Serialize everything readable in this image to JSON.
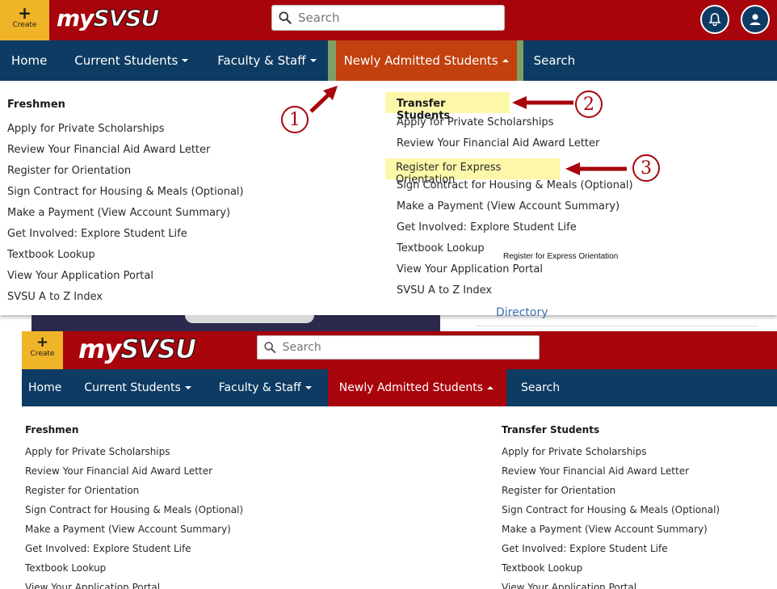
{
  "header": {
    "create_label": "Create",
    "create_symbol": "+",
    "logo_prefix": "my",
    "logo_brand": "SVSU",
    "search_placeholder": "Search"
  },
  "nav": {
    "home": "Home",
    "current_students": "Current Students",
    "faculty_staff": "Faculty & Staff",
    "newly_admitted": "Newly Admitted Students",
    "search": "Search"
  },
  "freshmen": {
    "heading": "Freshmen",
    "links": [
      "Apply for Private Scholarships",
      "Review Your Financial Aid Award Letter",
      "Register for Orientation",
      "Sign Contract for Housing & Meals (Optional)",
      "Make a Payment (View Account Summary)",
      "Get Involved: Explore Student Life",
      "Textbook Lookup",
      "View Your Application Portal",
      "SVSU A to Z Index"
    ]
  },
  "transfer": {
    "heading": "Transfer Students",
    "links_top": [
      "Apply for Private Scholarships",
      "Review Your Financial Aid Award Letter",
      "Register for Express Orientation",
      "Sign Contract for Housing & Meals (Optional)",
      "Make a Payment (View Account Summary)",
      "Get Involved: Explore Student Life",
      "Textbook Lookup",
      "View Your Application Portal",
      "SVSU A to Z Index"
    ],
    "links_bottom": [
      "Apply for Private Scholarships",
      "Review Your Financial Aid Award Letter",
      "Register for Orientation",
      "Sign Contract for Housing & Meals (Optional)",
      "Make a Payment (View Account Summary)",
      "Get Involved: Explore Student Life",
      "Textbook Lookup",
      "View Your Application Portal"
    ]
  },
  "annotations": {
    "one": "1",
    "two": "2",
    "three": "3",
    "tooltip": "Register for Express Orientation",
    "behind_link": "Directory"
  },
  "colors": {
    "brand_red": "#a8040c",
    "nav_blue": "#0e3b63",
    "active_orange": "#c2410f",
    "create_gold": "#f0b428",
    "highlight_yellow": "#fdf7a9"
  }
}
